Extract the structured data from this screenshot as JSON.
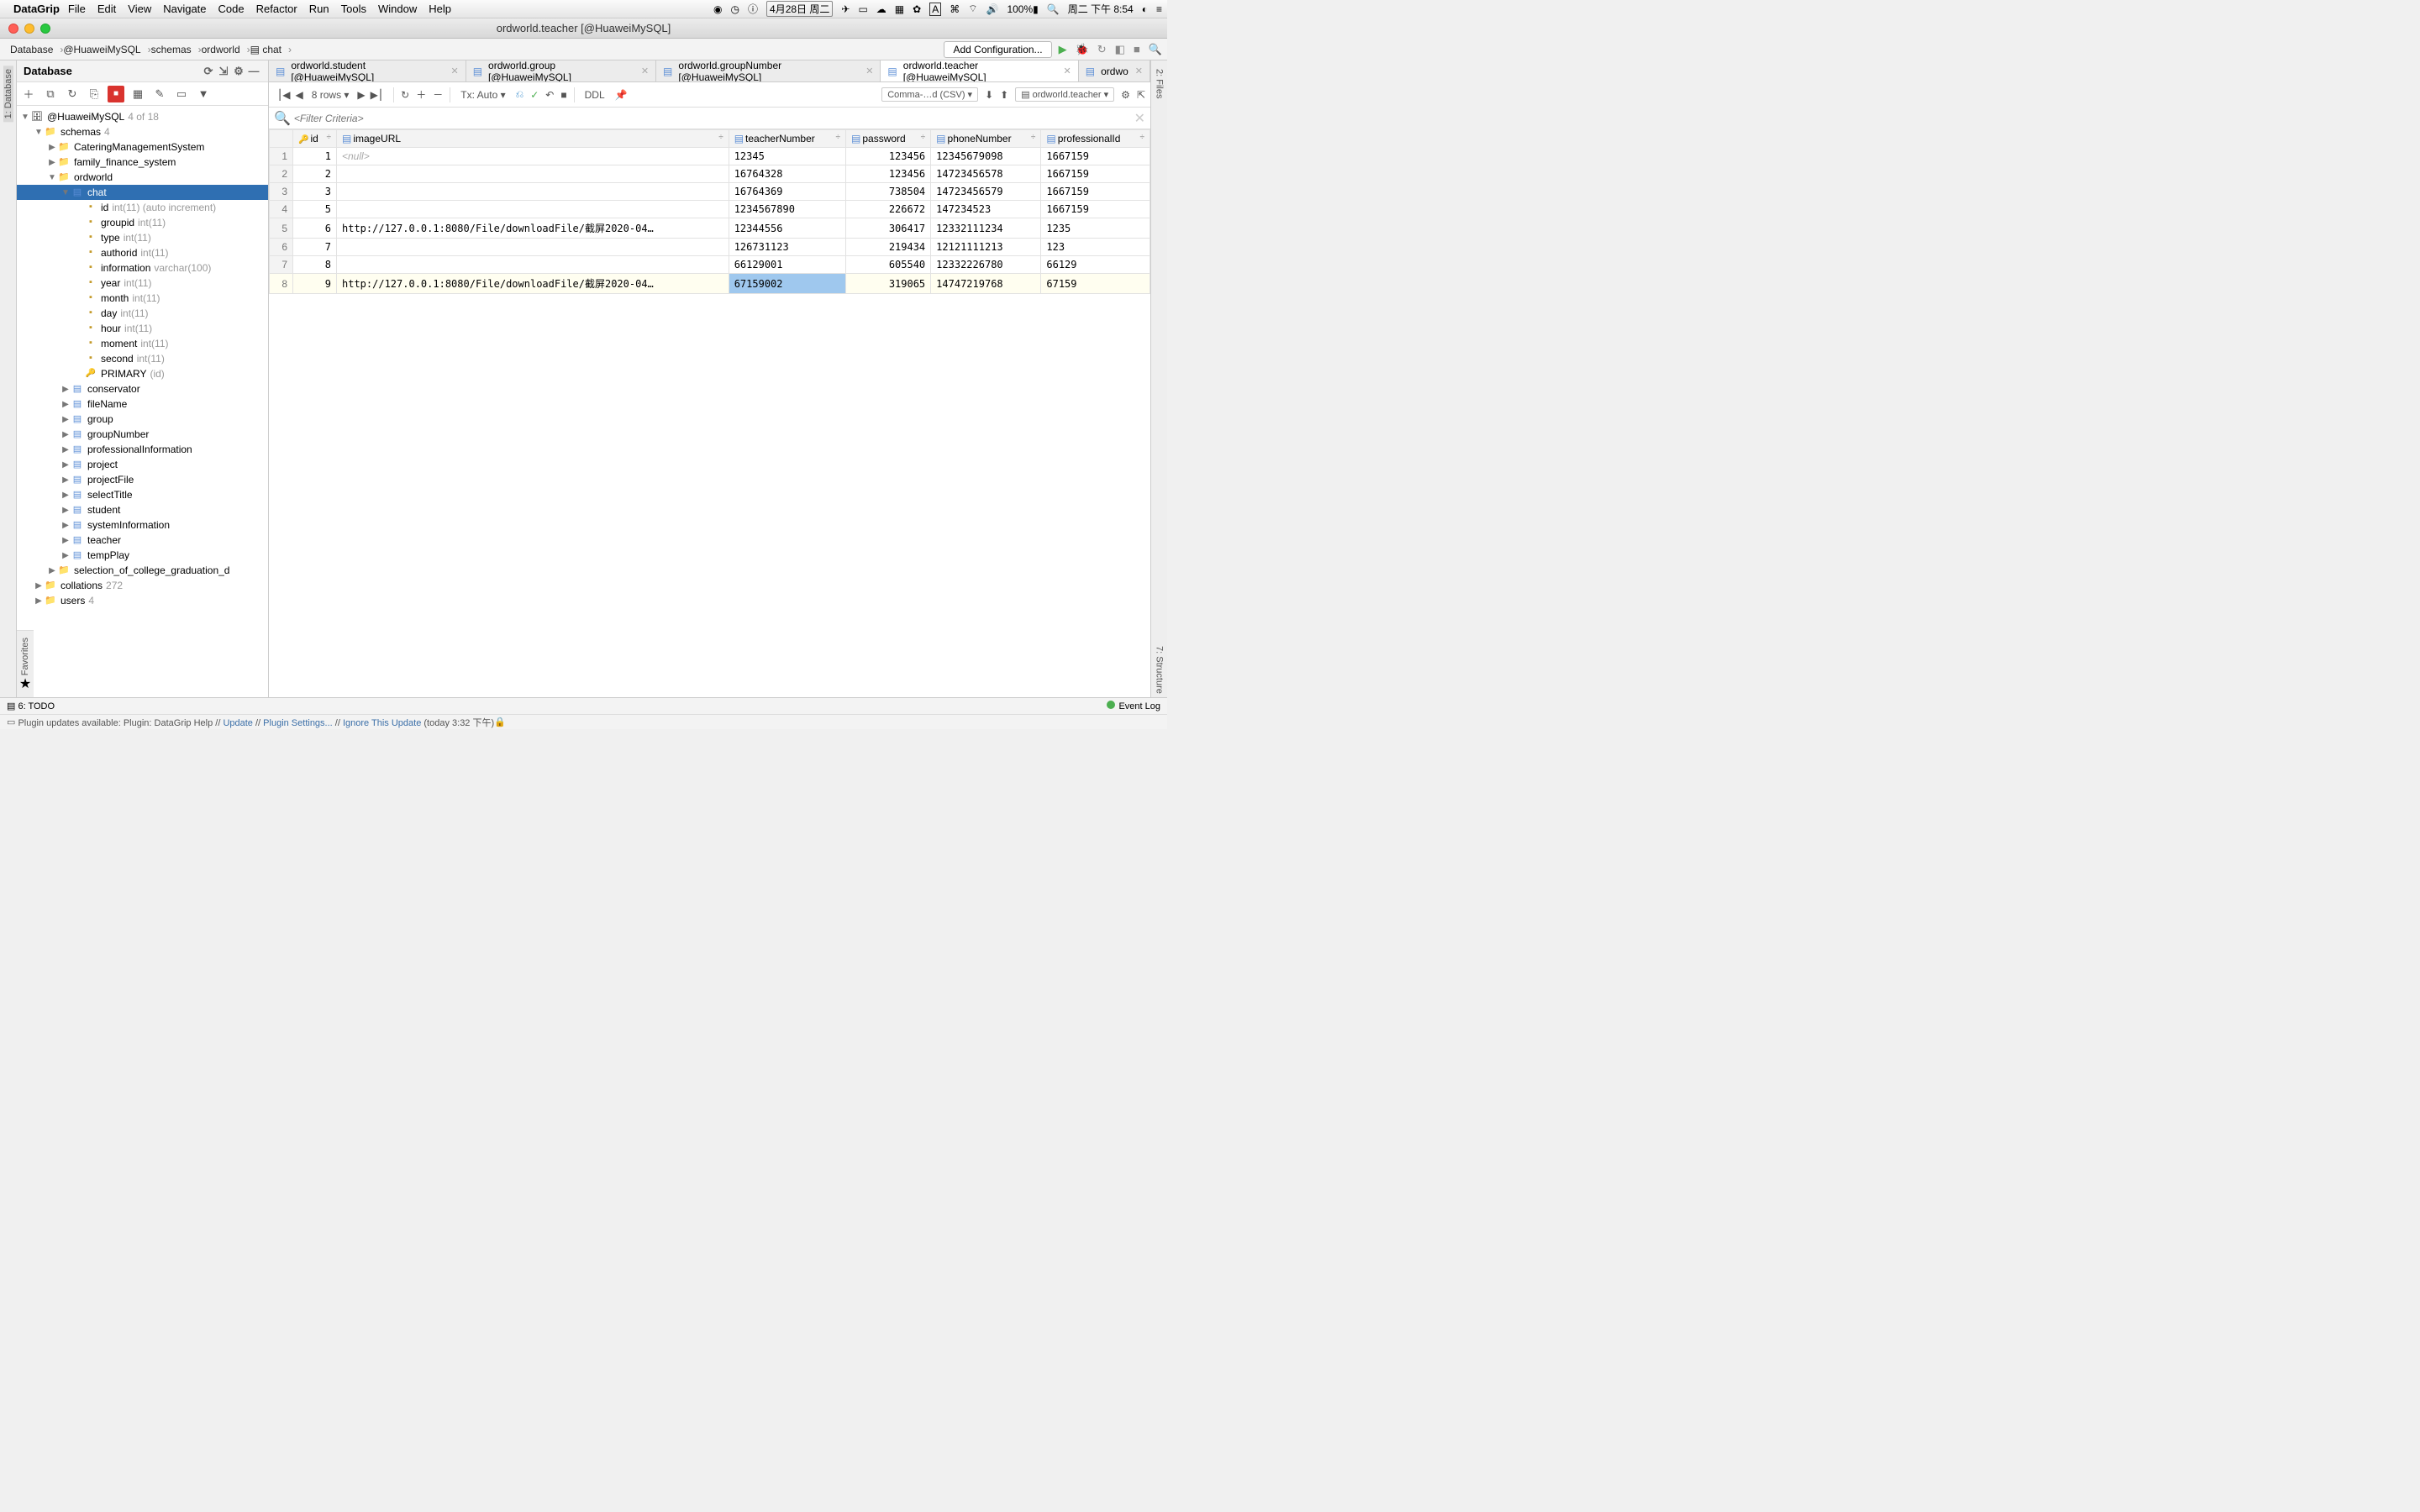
{
  "menubar": {
    "appname": "DataGrip",
    "items": [
      "File",
      "Edit",
      "View",
      "Navigate",
      "Code",
      "Refactor",
      "Run",
      "Tools",
      "Window",
      "Help"
    ],
    "date_box": "4月28日 周二",
    "battery": "100%",
    "clock": "周二 下午 8:54"
  },
  "titlebar": {
    "title": "ordworld.teacher [@HuaweiMySQL]"
  },
  "breadcrumbs": [
    "Database",
    "@HuaweiMySQL",
    "schemas",
    "ordworld",
    "chat"
  ],
  "run_config": {
    "placeholder": "Add Configuration..."
  },
  "sidebar": {
    "title": "Database",
    "root": {
      "name": "@HuaweiMySQL",
      "meta": "4 of 18"
    },
    "schemas_label": "schemas",
    "schemas_meta": "4",
    "databases": [
      "CateringManagementSystem",
      "family_finance_system",
      "ordworld"
    ],
    "selected_table": "chat",
    "chat_columns": [
      {
        "name": "id",
        "type": "int(11) (auto increment)"
      },
      {
        "name": "groupid",
        "type": "int(11)"
      },
      {
        "name": "type",
        "type": "int(11)"
      },
      {
        "name": "authorid",
        "type": "int(11)"
      },
      {
        "name": "information",
        "type": "varchar(100)"
      },
      {
        "name": "year",
        "type": "int(11)"
      },
      {
        "name": "month",
        "type": "int(11)"
      },
      {
        "name": "day",
        "type": "int(11)"
      },
      {
        "name": "hour",
        "type": "int(11)"
      },
      {
        "name": "moment",
        "type": "int(11)"
      },
      {
        "name": "second",
        "type": "int(11)"
      }
    ],
    "primary": {
      "label": "PRIMARY",
      "meta": "(id)"
    },
    "other_tables": [
      "conservator",
      "fileName",
      "group",
      "groupNumber",
      "professionalInformation",
      "project",
      "projectFile",
      "selectTitle",
      "student",
      "systemInformation",
      "teacher",
      "tempPlay"
    ],
    "extra_schema": "selection_of_college_graduation_d",
    "collations": {
      "label": "collations",
      "meta": "272"
    },
    "users": {
      "label": "users",
      "meta": "4"
    }
  },
  "tabs": [
    {
      "label": "ordworld.student [@HuaweiMySQL]",
      "active": false
    },
    {
      "label": "ordworld.group [@HuaweiMySQL]",
      "active": false
    },
    {
      "label": "ordworld.groupNumber [@HuaweiMySQL]",
      "active": false
    },
    {
      "label": "ordworld.teacher [@HuaweiMySQL]",
      "active": true
    },
    {
      "label": "ordwo",
      "active": false
    }
  ],
  "data_toolbar": {
    "rows": "8 rows",
    "tx": "Tx: Auto",
    "ddl": "DDL",
    "export_fmt": "Comma-…d (CSV)",
    "scope": "ordworld.teacher"
  },
  "filter_placeholder": "<Filter Criteria>",
  "columns": [
    "id",
    "imageURL",
    "teacherNumber",
    "password",
    "phoneNumber",
    "professionalId"
  ],
  "rows": [
    {
      "n": 1,
      "id": 1,
      "imageURL": null,
      "teacherNumber": "12345",
      "password": "123456",
      "phoneNumber": "12345679098",
      "professionalId": "1667159"
    },
    {
      "n": 2,
      "id": 2,
      "imageURL": "",
      "teacherNumber": "16764328",
      "password": "123456",
      "phoneNumber": "14723456578",
      "professionalId": "1667159"
    },
    {
      "n": 3,
      "id": 3,
      "imageURL": "",
      "teacherNumber": "16764369",
      "password": "738504",
      "phoneNumber": "14723456579",
      "professionalId": "1667159"
    },
    {
      "n": 4,
      "id": 5,
      "imageURL": "",
      "teacherNumber": "1234567890",
      "password": "226672",
      "phoneNumber": "147234523",
      "professionalId": "1667159"
    },
    {
      "n": 5,
      "id": 6,
      "imageURL": "http://127.0.0.1:8080/File/downloadFile/截屏2020-04…",
      "teacherNumber": "12344556",
      "password": "306417",
      "phoneNumber": "12332111234",
      "professionalId": "1235"
    },
    {
      "n": 6,
      "id": 7,
      "imageURL": "",
      "teacherNumber": "126731123",
      "password": "219434",
      "phoneNumber": "12121111213",
      "professionalId": "123"
    },
    {
      "n": 7,
      "id": 8,
      "imageURL": "",
      "teacherNumber": "66129001",
      "password": "605540",
      "phoneNumber": "12332226780",
      "professionalId": "66129"
    },
    {
      "n": 8,
      "id": 9,
      "imageURL": "http://127.0.0.1:8080/File/downloadFile/截屏2020-04…",
      "teacherNumber": "67159002",
      "password": "319065",
      "phoneNumber": "14747219768",
      "professionalId": "67159"
    }
  ],
  "selected_row_index": 7,
  "selected_cell_col": "teacherNumber",
  "bottom": {
    "todo": "6: TODO",
    "eventlog": "Event Log"
  },
  "status": {
    "msg_prefix": "Plugin updates available: Plugin: DataGrip Help // ",
    "link1": "Update",
    "sep": " // ",
    "link2": "Plugin Settings...",
    "link3": "Ignore This Update",
    "suffix": " (today 3:32 下午)"
  },
  "leftstrip": {
    "database": "1: Database"
  },
  "rightstrip": {
    "files": "2: Files",
    "structure": "7: Structure"
  },
  "favorites": "Favorites"
}
